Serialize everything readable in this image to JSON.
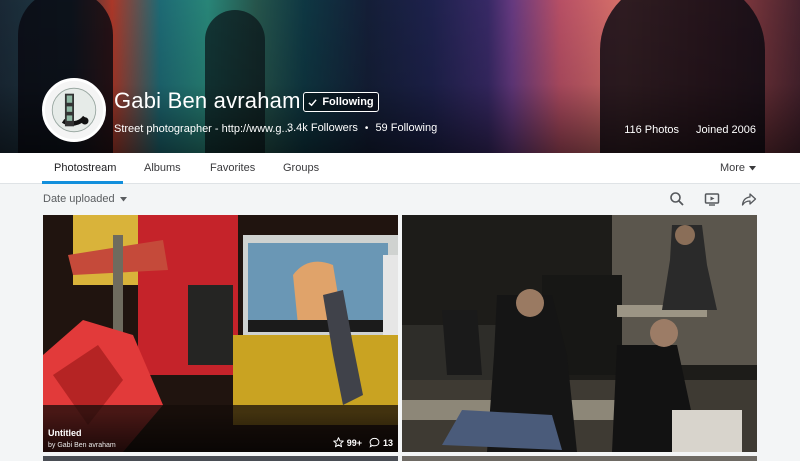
{
  "profile": {
    "name": "Gabi Ben avraham",
    "follow_label": "Following",
    "bio": "Street photographer - http://www.g...",
    "followers": "3.4k Followers",
    "separator": "•",
    "following": "59 Following",
    "photos_count": "116 Photos",
    "joined": "Joined 2006"
  },
  "tabs": {
    "photostream": "Photostream",
    "albums": "Albums",
    "favorites": "Favorites",
    "groups": "Groups",
    "more": "More"
  },
  "toolbar": {
    "sort_label": "Date uploaded",
    "icons": [
      "search-icon",
      "slideshow-icon",
      "share-icon"
    ]
  },
  "photos": [
    {
      "title": "Untitled",
      "author": "by Gabi Ben avraham",
      "faves": "99+",
      "comments": "13"
    }
  ],
  "colors": {
    "accent": "#128fdc",
    "header_text": "#ffffff"
  }
}
